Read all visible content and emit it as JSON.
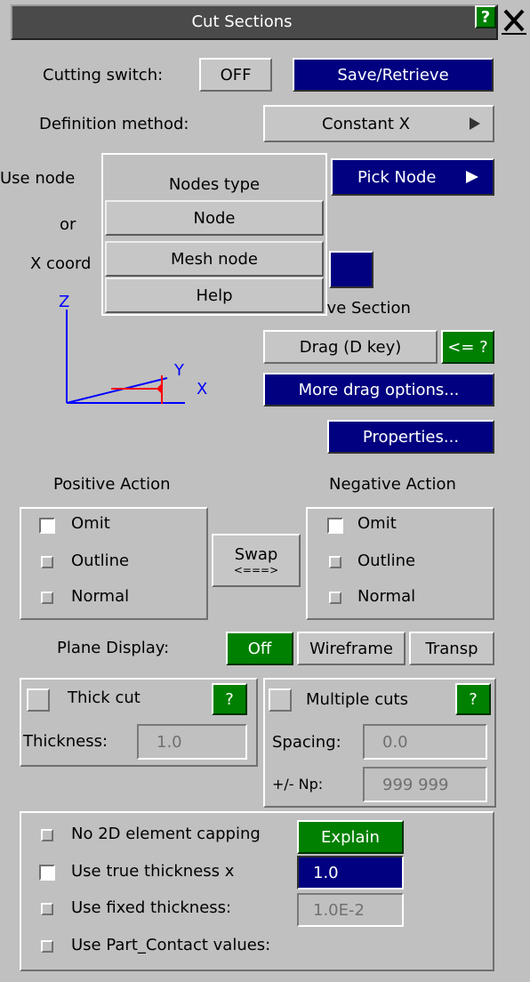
{
  "window": {
    "title": "Cut Sections",
    "help_label": "?",
    "close_label": "X"
  },
  "top": {
    "cutting_switch_label": "Cutting switch:",
    "cutting_switch_value": "OFF",
    "save_retrieve": "Save/Retrieve",
    "definition_method_label": "Definition method:",
    "definition_method_value": "Constant X",
    "use_node_label": "Use node",
    "pick_node": "Pick Node",
    "or_label": "or",
    "x_coord_label": "X coord"
  },
  "popup": {
    "title": "Nodes type",
    "items": [
      "Node",
      "Mesh node",
      "Help"
    ]
  },
  "axes": {
    "z": "Z",
    "y": "Y",
    "x": "X"
  },
  "move": {
    "label": "Move Section",
    "drag": "Drag (D key)",
    "drag_key": "<= ?",
    "more_drag": "More drag options...",
    "properties": "Properties..."
  },
  "actions": {
    "positive_title": "Positive Action",
    "negative_title": "Negative Action",
    "options": [
      "Omit",
      "Outline",
      "Normal"
    ],
    "swap_label": "Swap",
    "swap_arrow": "<===>"
  },
  "plane_display": {
    "label": "Plane Display:",
    "off": "Off",
    "wireframe": "Wireframe",
    "transp": "Transp"
  },
  "thick_cut": {
    "label": "Thick cut",
    "help": "?",
    "thickness_label": "Thickness:",
    "thickness_value": "1.0"
  },
  "multiple_cuts": {
    "label": "Multiple cuts",
    "help": "?",
    "spacing_label": "Spacing:",
    "spacing_value": "0.0",
    "np_label": "+/- Np:",
    "np_value": "999 999"
  },
  "bottom": {
    "no_2d_capping": "No 2D element capping",
    "explain": "Explain",
    "use_true_thickness": "Use true thickness  x",
    "true_thickness_value": "1.0",
    "use_fixed_thickness": "Use fixed thickness:",
    "fixed_thickness_value": "1.0E-2",
    "use_part_contact": "Use Part_Contact values:"
  },
  "colors": {
    "panel": "#c0c0c0",
    "blue": "#000080",
    "green": "#008000",
    "title_bar": "#4a4a4a",
    "axis_blue": "#0000ff",
    "axis_red": "#ff0000"
  }
}
